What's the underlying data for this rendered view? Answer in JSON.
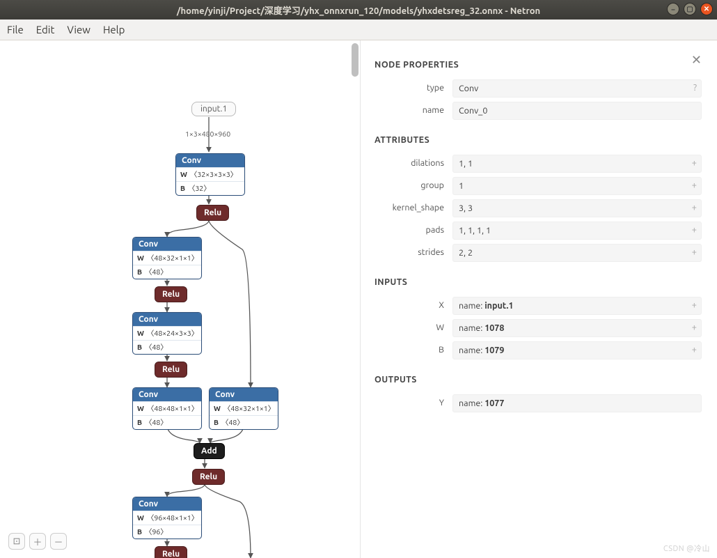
{
  "window": {
    "title": "/home/yinji/Project/深度学习/yhx_onnxrun_120/models/yhxdetsreg_32.onnx - Netron"
  },
  "menubar": {
    "file": "File",
    "edit": "Edit",
    "view": "View",
    "help": "Help"
  },
  "graph": {
    "input_node": "input.1",
    "input_shape": "1×3×480×960",
    "conv0": {
      "label": "Conv",
      "w": "〈32×3×3×3〉",
      "b": "〈32〉"
    },
    "relu": "Relu",
    "conv1": {
      "label": "Conv",
      "w": "〈48×32×1×1〉",
      "b": "〈48〉"
    },
    "conv2": {
      "label": "Conv",
      "w": "〈48×24×3×3〉",
      "b": "〈48〉"
    },
    "conv3": {
      "label": "Conv",
      "w": "〈48×48×1×1〉",
      "b": "〈48〉"
    },
    "conv4": {
      "label": "Conv",
      "w": "〈48×32×1×1〉",
      "b": "〈48〉"
    },
    "add": "Add",
    "conv5": {
      "label": "Conv",
      "w": "〈96×48×1×1〉",
      "b": "〈96〉"
    }
  },
  "panel": {
    "header": "NODE PROPERTIES",
    "type_label": "type",
    "type_value": "Conv",
    "type_hint": "?",
    "name_label": "name",
    "name_value": "Conv_0",
    "attributes_header": "ATTRIBUTES",
    "attrs": {
      "dilations_label": "dilations",
      "dilations_value": "1, 1",
      "group_label": "group",
      "group_value": "1",
      "kernel_shape_label": "kernel_shape",
      "kernel_shape_value": "3, 3",
      "pads_label": "pads",
      "pads_value": "1, 1, 1, 1",
      "strides_label": "strides",
      "strides_value": "2, 2"
    },
    "inputs_header": "INPUTS",
    "inputs": {
      "x_label": "X",
      "x_name_prefix": "name: ",
      "x_name": "input.1",
      "w_label": "W",
      "w_name_prefix": "name: ",
      "w_name": "1078",
      "b_label": "B",
      "b_name_prefix": "name: ",
      "b_name": "1079"
    },
    "outputs_header": "OUTPUTS",
    "outputs": {
      "y_label": "Y",
      "y_name_prefix": "name: ",
      "y_name": "1077"
    },
    "plus": "+"
  },
  "watermark": "CSDN @冷山"
}
